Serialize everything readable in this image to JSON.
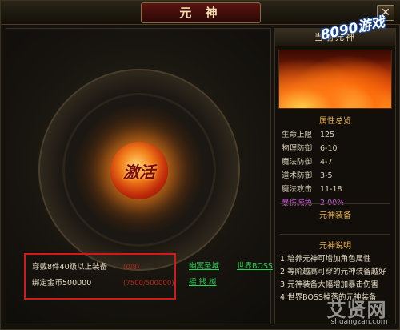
{
  "window": {
    "title": "元 神",
    "close_label": "✕"
  },
  "stage": {
    "orb_text": "激活"
  },
  "requirements": [
    {
      "label": "穿戴8件40级以上装备",
      "value": "(0/8)"
    },
    {
      "label": "绑定金币500000",
      "value": "(7500/500000)"
    }
  ],
  "links": {
    "nether_realm": "幽冥圣域",
    "world_boss": "世界BOSS",
    "money_tree": "摇 钱 树"
  },
  "side": {
    "header": "当前元神",
    "attributes_title": "属性总览",
    "stats": [
      {
        "name": "生命上限",
        "value": "125"
      },
      {
        "name": "物理防御",
        "value": "6-10"
      },
      {
        "name": "魔法防御",
        "value": "4-7"
      },
      {
        "name": "道术防御",
        "value": "3-5"
      },
      {
        "name": "魔法攻击",
        "value": "11-18"
      },
      {
        "name": "暴伤减免",
        "value": "2.00%"
      }
    ],
    "equipment_title": "元神装备",
    "notes_title": "元神说明",
    "notes": [
      "1.培养元神可增加角色属性",
      "2.等阶越高可穿的元神装备越好",
      "3.元神装备大幅增加暴击伤害",
      "4.世界BOSS掉落的元神装备"
    ]
  },
  "watermarks": {
    "badge": "8090游戏",
    "site_cn": "艾贤网",
    "site_url": "shuangzan.com"
  },
  "colors": {
    "requirement_border": "#d21a1a",
    "link": "#2fd05a",
    "highlight_stat": "#c65ad8",
    "section_title": "#e8b04a"
  }
}
